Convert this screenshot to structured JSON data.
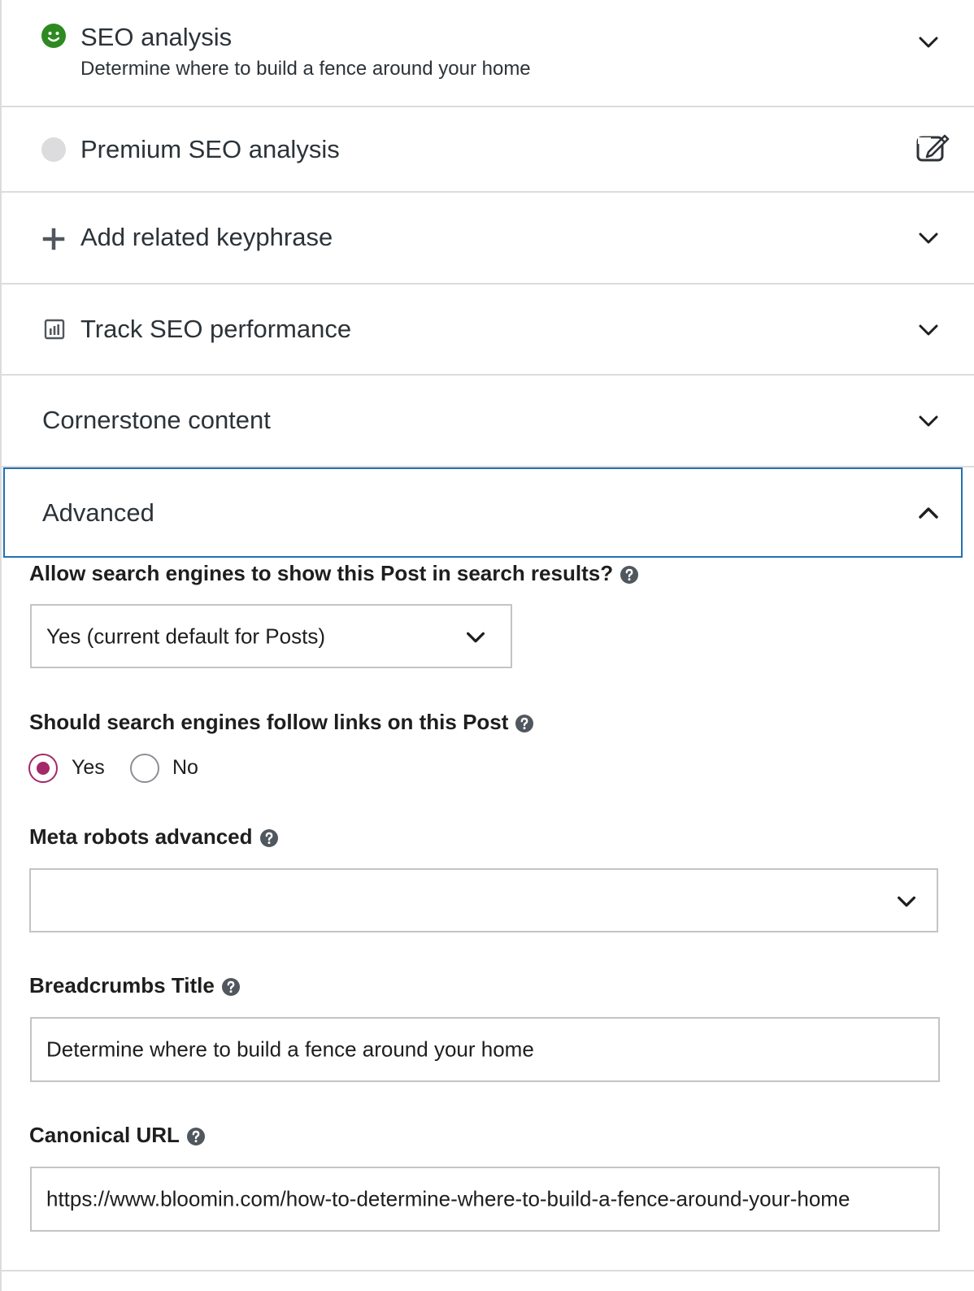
{
  "sections": {
    "seo_analysis": {
      "title": "SEO analysis",
      "subtitle": "Determine where to build a fence around your home"
    },
    "premium": {
      "title": "Premium SEO analysis"
    },
    "related": {
      "title": "Add related keyphrase"
    },
    "track": {
      "title": "Track SEO performance"
    },
    "cornerstone": {
      "title": "Cornerstone content"
    },
    "advanced": {
      "title": "Advanced"
    }
  },
  "advanced": {
    "allow_label": "Allow search engines to show this Post in search results?",
    "allow_value": "Yes (current default for Posts)",
    "follow_label": "Should search engines follow links on this Post",
    "follow_options": [
      "Yes",
      "No"
    ],
    "follow_selected": "Yes",
    "meta_label": "Meta robots advanced",
    "meta_value": "",
    "breadcrumbs_label": "Breadcrumbs Title",
    "breadcrumbs_value": "Determine where to build a fence around your home",
    "canonical_label": "Canonical URL",
    "canonical_value": "https://www.bloomin.com/how-to-determine-where-to-build-a-fence-around-your-home"
  },
  "colors": {
    "good": "#2d8a21",
    "accent": "#a4286a",
    "focus": "#2271b1",
    "neutral": "#dcdcde"
  },
  "icons": [
    "smiley-face-icon",
    "gray-dot-icon",
    "edit-icon",
    "plus-icon",
    "chart-icon",
    "chevron-down-icon",
    "chevron-up-icon",
    "help-icon"
  ]
}
